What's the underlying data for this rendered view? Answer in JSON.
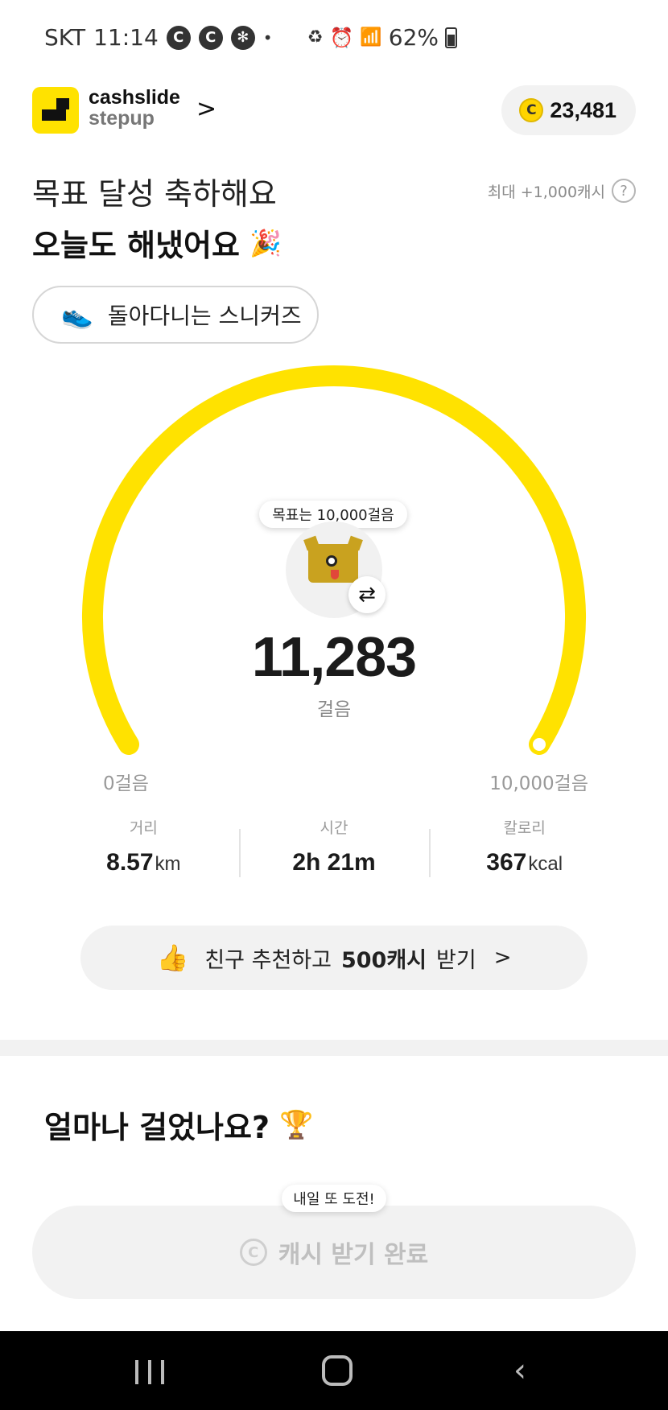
{
  "status_bar": {
    "carrier": "SKT",
    "time": "11:14",
    "battery": "62%",
    "notification_icons": [
      "c-icon",
      "c-icon",
      "fan-icon",
      "dot-icon"
    ],
    "system_icons": [
      "recycle-icon",
      "alarm-icon",
      "wifi-icon",
      "signal-icon",
      "battery-icon"
    ]
  },
  "header": {
    "brand_line1": "cashslide",
    "brand_line2": "stepup",
    "chevron": ">",
    "cash_amount": "23,481",
    "coin_symbol": "C"
  },
  "goal": {
    "title": "목표 달성 축하해요",
    "subtitle": "오늘도 해냈어요",
    "max_cash": "최대 +1,000캐시",
    "help_symbol": "?",
    "sneaker_label": "돌아다니는 스니커즈"
  },
  "gauge": {
    "goal_tooltip": "목표는 10,000걸음",
    "steps": "11,283",
    "unit": "걸음",
    "range_min": "0걸음",
    "range_max": "10,000걸음",
    "swap_symbol": "⇄",
    "color": "#ffe200",
    "progress_fraction": 1.0
  },
  "stats": [
    {
      "label": "거리",
      "value": "8.57",
      "unit": "km"
    },
    {
      "label": "시간",
      "value": "2h 21m",
      "unit": ""
    },
    {
      "label": "칼로리",
      "value": "367",
      "unit": "kcal"
    }
  ],
  "invite": {
    "prefix": "친구 추천하고",
    "bold": "500캐시",
    "suffix": "받기",
    "chevron": ">"
  },
  "walk_section": {
    "title": "얼마나 걸었나요?",
    "tooltip": "내일 또 도전!",
    "button_label": "캐시 받기 완료",
    "medal_symbol": "C"
  },
  "colors": {
    "accent": "#ffe200",
    "pill_bg": "#f2f2f2"
  }
}
